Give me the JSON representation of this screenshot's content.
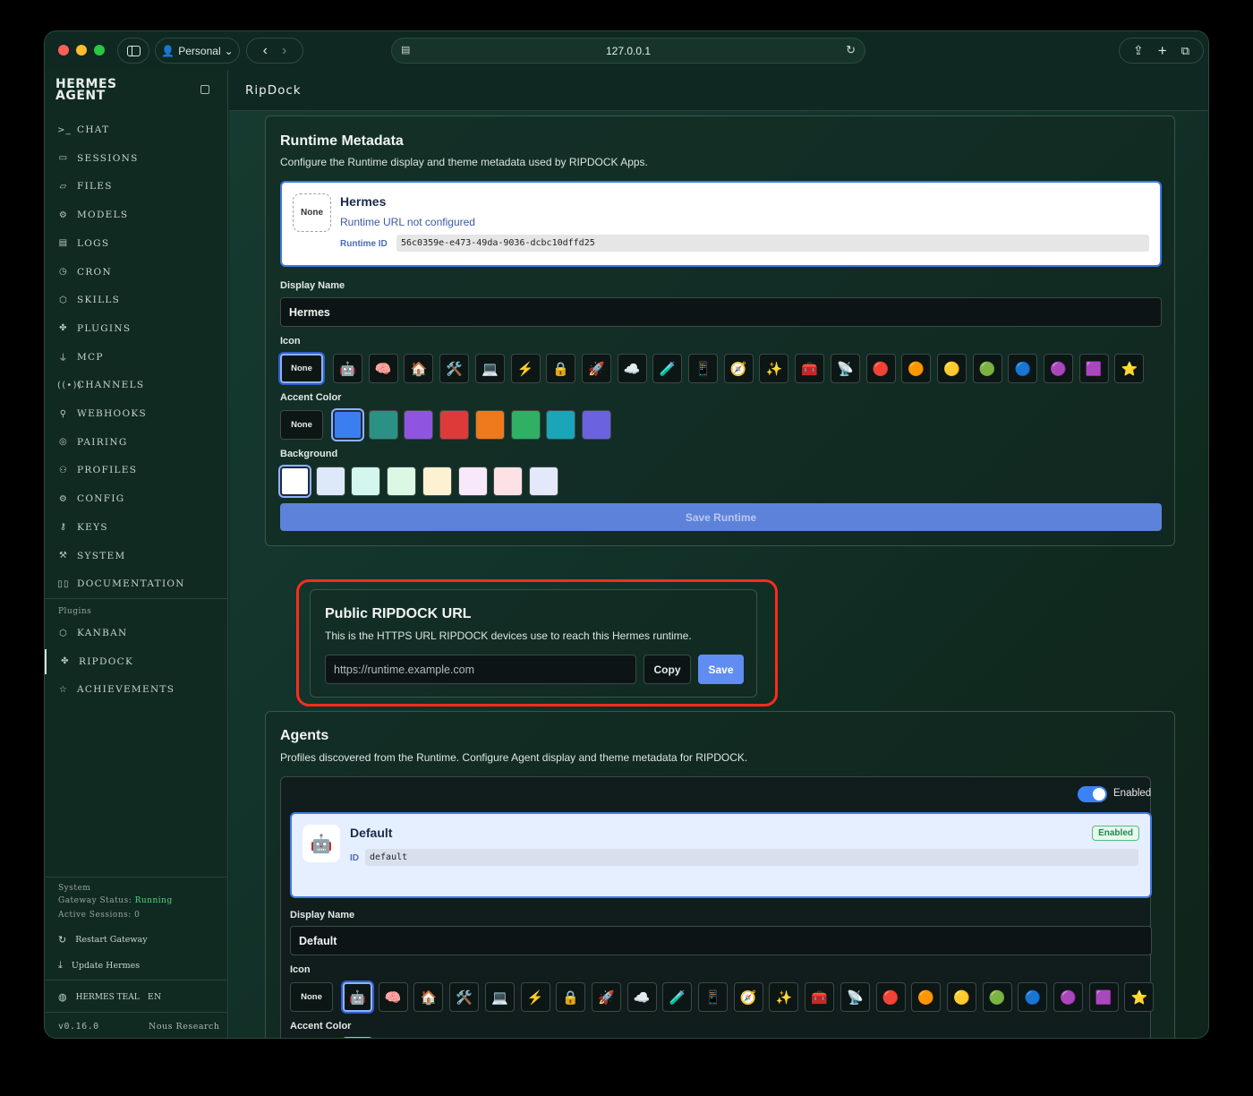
{
  "browser": {
    "profile": "Personal",
    "url": "127.0.0.1"
  },
  "sidebar": {
    "brand_line1": "HERMES",
    "brand_line2": "AGENT",
    "items": [
      {
        "label": "CHAT",
        "icon": ">_"
      },
      {
        "label": "SESSIONS",
        "icon": "▭"
      },
      {
        "label": "FILES",
        "icon": "▱"
      },
      {
        "label": "MODELS",
        "icon": "⚙"
      },
      {
        "label": "LOGS",
        "icon": "▤"
      },
      {
        "label": "CRON",
        "icon": "◷"
      },
      {
        "label": "SKILLS",
        "icon": "⬡"
      },
      {
        "label": "PLUGINS",
        "icon": "✤"
      },
      {
        "label": "MCP",
        "icon": "⏚"
      },
      {
        "label": "CHANNELS",
        "icon": "((•))"
      },
      {
        "label": "WEBHOOKS",
        "icon": "⚲"
      },
      {
        "label": "PAIRING",
        "icon": "◎"
      },
      {
        "label": "PROFILES",
        "icon": "⚇"
      },
      {
        "label": "CONFIG",
        "icon": "⚙"
      },
      {
        "label": "KEYS",
        "icon": "⚷"
      },
      {
        "label": "SYSTEM",
        "icon": "⚒"
      },
      {
        "label": "DOCUMENTATION",
        "icon": "▯▯"
      }
    ],
    "plugins_heading": "Plugins",
    "plugins": [
      {
        "label": "KANBAN",
        "icon": "⬡"
      },
      {
        "label": "RIPDOCK",
        "icon": "✤"
      },
      {
        "label": "ACHIEVEMENTS",
        "icon": "☆"
      }
    ],
    "system_heading": "System",
    "gateway_status_label": "Gateway Status:",
    "gateway_status_value": "Running",
    "active_sessions": "Active Sessions: 0",
    "restart_label": "Restart Gateway",
    "update_label": "Update Hermes",
    "theme_label": "HERMES TEAL",
    "lang_label": "EN",
    "version": "v0.16.0",
    "vendor": "Nous Research"
  },
  "header": {
    "title": "RipDock"
  },
  "runtime": {
    "title": "Runtime Metadata",
    "description": "Configure the Runtime display and theme metadata used by RIPDOCK Apps.",
    "preview_icon_text": "None",
    "preview_name": "Hermes",
    "preview_status": "Runtime URL not configured",
    "runtime_id_label": "Runtime ID",
    "runtime_id": "56c0359e-e473-49da-9036-dcbc10dffd25",
    "display_name_label": "Display Name",
    "display_name_value": "Hermes",
    "icon_label": "Icon",
    "accent_label": "Accent Color",
    "background_label": "Background",
    "save_label": "Save Runtime"
  },
  "icon_none_label": "None",
  "icons": [
    "🤖",
    "🧠",
    "🏠",
    "🛠️",
    "💻",
    "⚡",
    "🔒",
    "🚀",
    "☁️",
    "🧪",
    "📱",
    "🧭",
    "✨",
    "🧰",
    "📡",
    "🔴",
    "🟠",
    "🟡",
    "🟢",
    "🔵",
    "🟣",
    "🟪",
    "⭐"
  ],
  "accent_colors": [
    "#3b7ef0",
    "#2a9285",
    "#8f55e0",
    "#de3a3a",
    "#ee7a1c",
    "#2fb065",
    "#1aa5b8",
    "#6b62e0"
  ],
  "backgrounds": [
    "#ffffff",
    "#dde8fb",
    "#d3f7ee",
    "#dbf8e4",
    "#fcf2d2",
    "#f8e8fb",
    "#fde1e4",
    "#e3e8fb"
  ],
  "public_url": {
    "title": "Public RIPDOCK URL",
    "description": "This is the HTTPS URL RIPDOCK devices use to reach this Hermes runtime.",
    "placeholder": "https://runtime.example.com",
    "copy_label": "Copy",
    "save_label": "Save"
  },
  "agents": {
    "title": "Agents",
    "description": "Profiles discovered from the Runtime. Configure Agent display and theme metadata for RIPDOCK.",
    "enabled_toggle_label": "Enabled",
    "agent_name": "Default",
    "agent_badge": "Enabled",
    "agent_icon": "🤖",
    "id_label": "ID",
    "agent_id": "default",
    "display_name_label": "Display Name",
    "display_name_value": "Default",
    "icon_label": "Icon",
    "accent_label": "Accent Color"
  }
}
